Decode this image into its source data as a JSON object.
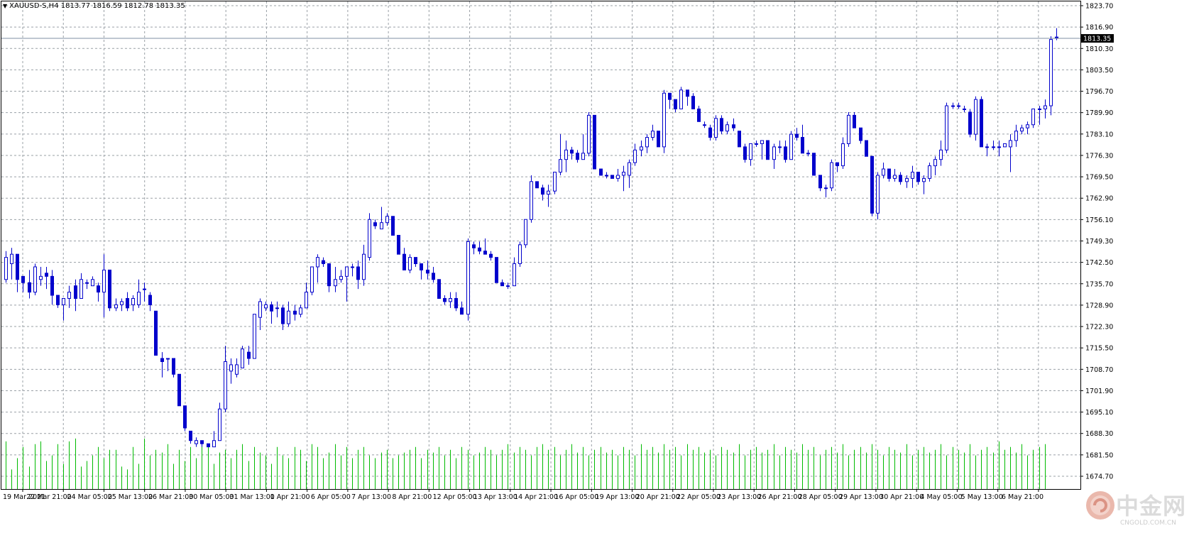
{
  "header": {
    "symbol_line": "XAUUSD-S,H4  1813.77 1816.59 1812.78 1813.35"
  },
  "price_axis": {
    "labels": [
      "1823.70",
      "1816.90",
      "1810.30",
      "1803.50",
      "1796.70",
      "1789.90",
      "1783.10",
      "1776.30",
      "1769.50",
      "1762.90",
      "1756.10",
      "1749.30",
      "1742.50",
      "1735.70",
      "1728.90",
      "1722.30",
      "1715.50",
      "1708.70",
      "1701.90",
      "1695.10",
      "1688.30",
      "1681.50",
      "1674.70"
    ],
    "current_price_label": "1813.35"
  },
  "time_axis": {
    "labels": [
      "19 Mar 2021",
      "22 Mar 21:00",
      "24 Mar 05:00",
      "25 Mar 13:00",
      "26 Mar 21:00",
      "30 Mar 05:00",
      "31 Mar 13:00",
      "1 Apr 21:00",
      "6 Apr 05:00",
      "7 Apr 13:00",
      "8 Apr 21:00",
      "12 Apr 05:00",
      "13 Apr 13:00",
      "14 Apr 21:00",
      "16 Apr 05:00",
      "19 Apr 13:00",
      "20 Apr 21:00",
      "22 Apr 05:00",
      "23 Apr 13:00",
      "26 Apr 21:00",
      "28 Apr 05:00",
      "29 Apr 13:00",
      "30 Apr 21:00",
      "4 May 05:00",
      "5 May 13:00",
      "6 May 21:00"
    ]
  },
  "watermark": {
    "brand_text": "中金网",
    "site_text": "CNGOLD.COM.CN"
  },
  "colors": {
    "candle": "#0000cc",
    "volume": "#00bb00",
    "grid": "#9aa0a6",
    "price_line": "#7f8fa3"
  },
  "chart_data": {
    "type": "candlestick",
    "timeframe": "H4",
    "symbol": "XAUUSD-S",
    "last_bar": {
      "open": 1813.77,
      "high": 1816.59,
      "low": 1812.78,
      "close": 1813.35
    },
    "ylim": [
      1674.7,
      1823.7
    ],
    "grid": true,
    "candles_ohlc": [
      [
        1737,
        1746,
        1736,
        1744
      ],
      [
        1742,
        1747,
        1737,
        1745
      ],
      [
        1745,
        1745,
        1733,
        1737
      ],
      [
        1738,
        1738,
        1733,
        1736
      ],
      [
        1736,
        1740,
        1731,
        1733
      ],
      [
        1733,
        1742,
        1732,
        1741
      ],
      [
        1737,
        1741,
        1735,
        1738
      ],
      [
        1739,
        1741,
        1734,
        1738
      ],
      [
        1738,
        1740,
        1729,
        1732
      ],
      [
        1732,
        1732,
        1728,
        1729
      ],
      [
        1729,
        1731,
        1724,
        1731
      ],
      [
        1731,
        1735,
        1728,
        1733
      ],
      [
        1735,
        1737,
        1727,
        1731
      ],
      [
        1731,
        1739,
        1731,
        1737
      ],
      [
        1736,
        1737,
        1734,
        1736
      ],
      [
        1735,
        1738,
        1735,
        1737
      ],
      [
        1735,
        1736,
        1730,
        1733
      ],
      [
        1733,
        1745,
        1725,
        1740
      ],
      [
        1740,
        1740,
        1727,
        1728
      ],
      [
        1728,
        1731,
        1727,
        1729
      ],
      [
        1729,
        1731,
        1727,
        1730
      ],
      [
        1731,
        1733,
        1727,
        1728
      ],
      [
        1729,
        1732,
        1727,
        1731
      ],
      [
        1729,
        1737,
        1728,
        1733
      ],
      [
        1734,
        1736,
        1730,
        1734
      ],
      [
        1732,
        1733,
        1727,
        1729
      ],
      [
        1727,
        1727,
        1713,
        1713
      ],
      [
        1712,
        1714,
        1706,
        1711
      ],
      [
        1712,
        1712,
        1708,
        1712
      ],
      [
        1712,
        1712,
        1706,
        1707
      ],
      [
        1707,
        1707,
        1697,
        1697
      ],
      [
        1697,
        1697,
        1689,
        1690
      ],
      [
        1689,
        1689,
        1685,
        1686
      ],
      [
        1685,
        1687,
        1684,
        1686
      ],
      [
        1686,
        1686,
        1684,
        1685
      ],
      [
        1685,
        1685,
        1684,
        1684
      ],
      [
        1684,
        1689,
        1684,
        1686
      ],
      [
        1686,
        1698,
        1686,
        1696
      ],
      [
        1696,
        1716,
        1695,
        1711
      ],
      [
        1708,
        1712,
        1704,
        1710
      ],
      [
        1707,
        1712,
        1706,
        1710
      ],
      [
        1709,
        1716,
        1709,
        1715
      ],
      [
        1714,
        1716,
        1710,
        1712
      ],
      [
        1712,
        1725,
        1712,
        1726
      ],
      [
        1725,
        1731,
        1721,
        1730
      ],
      [
        1728,
        1730,
        1727,
        1729
      ],
      [
        1729,
        1730,
        1723,
        1727
      ],
      [
        1728,
        1730,
        1725,
        1728
      ],
      [
        1728,
        1729,
        1721,
        1723
      ],
      [
        1723,
        1730,
        1722,
        1727
      ],
      [
        1727,
        1729,
        1724,
        1726
      ],
      [
        1726,
        1729,
        1725,
        1728
      ],
      [
        1728,
        1736,
        1728,
        1733
      ],
      [
        1733,
        1741,
        1732,
        1741
      ],
      [
        1741,
        1745,
        1736,
        1744
      ],
      [
        1743,
        1744,
        1741,
        1742
      ],
      [
        1742,
        1742,
        1733,
        1735
      ],
      [
        1735,
        1741,
        1733,
        1737
      ],
      [
        1737,
        1740,
        1736,
        1738
      ],
      [
        1738,
        1741,
        1730,
        1741
      ],
      [
        1741,
        1742,
        1738,
        1741
      ],
      [
        1741,
        1743,
        1734,
        1737
      ],
      [
        1737,
        1748,
        1735,
        1745
      ],
      [
        1744,
        1758,
        1743,
        1756
      ],
      [
        1755,
        1756,
        1753,
        1754
      ],
      [
        1753,
        1760,
        1753,
        1755
      ],
      [
        1755,
        1758,
        1754,
        1757
      ],
      [
        1757,
        1757,
        1751,
        1751
      ],
      [
        1751,
        1751,
        1745,
        1745
      ],
      [
        1745,
        1747,
        1740,
        1740
      ],
      [
        1740,
        1745,
        1739,
        1744
      ],
      [
        1744,
        1744,
        1741,
        1742
      ],
      [
        1742,
        1742,
        1737,
        1740
      ],
      [
        1740,
        1743,
        1737,
        1739
      ],
      [
        1739,
        1741,
        1736,
        1737
      ],
      [
        1737,
        1737,
        1731,
        1731
      ],
      [
        1731,
        1732,
        1729,
        1730
      ],
      [
        1730,
        1733,
        1728,
        1731
      ],
      [
        1731,
        1733,
        1727,
        1728
      ],
      [
        1728,
        1730,
        1726,
        1726
      ],
      [
        1726,
        1750,
        1724,
        1749
      ],
      [
        1748,
        1749,
        1745,
        1747
      ],
      [
        1747,
        1749,
        1745,
        1746
      ],
      [
        1746,
        1750,
        1745,
        1745
      ],
      [
        1745,
        1746,
        1743,
        1744
      ],
      [
        1744,
        1744,
        1736,
        1736
      ],
      [
        1736,
        1737,
        1735,
        1735
      ],
      [
        1735,
        1736,
        1734,
        1735
      ],
      [
        1735,
        1744,
        1735,
        1742
      ],
      [
        1742,
        1749,
        1741,
        1748
      ],
      [
        1748,
        1756,
        1747,
        1756
      ],
      [
        1756,
        1770,
        1755,
        1768
      ],
      [
        1768,
        1768,
        1766,
        1766
      ],
      [
        1766,
        1767,
        1762,
        1764
      ],
      [
        1764,
        1767,
        1760,
        1765
      ],
      [
        1765,
        1771,
        1764,
        1771
      ],
      [
        1771,
        1783,
        1770,
        1775
      ],
      [
        1775,
        1781,
        1771,
        1778
      ],
      [
        1778,
        1779,
        1775,
        1777
      ],
      [
        1777,
        1778,
        1774,
        1775
      ],
      [
        1775,
        1783,
        1775,
        1777
      ],
      [
        1777,
        1790,
        1776,
        1789
      ],
      [
        1789,
        1789,
        1772,
        1772
      ],
      [
        1772,
        1772,
        1770,
        1770
      ],
      [
        1770,
        1771,
        1769,
        1770
      ],
      [
        1770,
        1770,
        1769,
        1769
      ],
      [
        1769,
        1772,
        1768,
        1770
      ],
      [
        1770,
        1773,
        1765,
        1771
      ],
      [
        1770,
        1775,
        1766,
        1774
      ],
      [
        1774,
        1780,
        1773,
        1778
      ],
      [
        1778,
        1781,
        1776,
        1779
      ],
      [
        1779,
        1783,
        1777,
        1782
      ],
      [
        1782,
        1786,
        1781,
        1784
      ],
      [
        1784,
        1784,
        1779,
        1779
      ],
      [
        1779,
        1797,
        1777,
        1796
      ],
      [
        1796,
        1796,
        1791,
        1794
      ],
      [
        1794,
        1794,
        1790,
        1791
      ],
      [
        1791,
        1798,
        1791,
        1797
      ],
      [
        1797,
        1797,
        1792,
        1795
      ],
      [
        1795,
        1796,
        1791,
        1791
      ],
      [
        1791,
        1792,
        1787,
        1787
      ],
      [
        1786,
        1787,
        1785,
        1786
      ],
      [
        1785,
        1786,
        1781,
        1782
      ],
      [
        1782,
        1789,
        1781,
        1788
      ],
      [
        1788,
        1789,
        1783,
        1784
      ],
      [
        1784,
        1787,
        1783,
        1786
      ],
      [
        1786,
        1788,
        1784,
        1785
      ],
      [
        1784,
        1784,
        1779,
        1779
      ],
      [
        1779,
        1780,
        1774,
        1775
      ],
      [
        1775,
        1780,
        1773,
        1780
      ],
      [
        1780,
        1781,
        1779,
        1780
      ],
      [
        1780,
        1781,
        1775,
        1781
      ],
      [
        1781,
        1781,
        1775,
        1775
      ],
      [
        1775,
        1780,
        1772,
        1779
      ],
      [
        1779,
        1781,
        1777,
        1779
      ],
      [
        1779,
        1781,
        1774,
        1775
      ],
      [
        1775,
        1784,
        1775,
        1783
      ],
      [
        1783,
        1785,
        1781,
        1782
      ],
      [
        1782,
        1786,
        1777,
        1777
      ],
      [
        1777,
        1778,
        1776,
        1777
      ],
      [
        1777,
        1777,
        1770,
        1770
      ],
      [
        1770,
        1770,
        1765,
        1766
      ],
      [
        1766,
        1767,
        1763,
        1766
      ],
      [
        1766,
        1775,
        1765,
        1774
      ],
      [
        1774,
        1774,
        1771,
        1773
      ],
      [
        1773,
        1782,
        1772,
        1780
      ],
      [
        1780,
        1790,
        1779,
        1789
      ],
      [
        1789,
        1790,
        1785,
        1785
      ],
      [
        1785,
        1785,
        1780,
        1781
      ],
      [
        1781,
        1781,
        1776,
        1776
      ],
      [
        1776,
        1776,
        1757,
        1758
      ],
      [
        1758,
        1771,
        1756,
        1770
      ],
      [
        1770,
        1774,
        1769,
        1772
      ],
      [
        1772,
        1772,
        1768,
        1769
      ],
      [
        1769,
        1772,
        1768,
        1770
      ],
      [
        1770,
        1771,
        1767,
        1768
      ],
      [
        1768,
        1770,
        1766,
        1769
      ],
      [
        1769,
        1773,
        1766,
        1771
      ],
      [
        1771,
        1771,
        1767,
        1768
      ],
      [
        1768,
        1770,
        1764,
        1769
      ],
      [
        1769,
        1774,
        1768,
        1773
      ],
      [
        1773,
        1776,
        1770,
        1775
      ],
      [
        1775,
        1781,
        1773,
        1778
      ],
      [
        1778,
        1793,
        1777,
        1792
      ],
      [
        1792,
        1793,
        1791,
        1792
      ],
      [
        1792,
        1793,
        1791,
        1792
      ],
      [
        1791,
        1792,
        1790,
        1791
      ],
      [
        1790,
        1791,
        1782,
        1783
      ],
      [
        1783,
        1795,
        1781,
        1794
      ],
      [
        1794,
        1795,
        1779,
        1779
      ],
      [
        1779,
        1780,
        1776,
        1779
      ],
      [
        1779,
        1781,
        1778,
        1779
      ],
      [
        1779,
        1781,
        1776,
        1779
      ],
      [
        1779,
        1780,
        1779,
        1780
      ],
      [
        1779,
        1783,
        1771,
        1781
      ],
      [
        1781,
        1786,
        1779,
        1784
      ],
      [
        1784,
        1786,
        1783,
        1785
      ],
      [
        1785,
        1787,
        1783,
        1786
      ],
      [
        1786,
        1791,
        1785,
        1791
      ],
      [
        1791,
        1792,
        1786,
        1791
      ],
      [
        1791,
        1794,
        1788,
        1792
      ],
      [
        1792,
        1814,
        1789,
        1813
      ],
      [
        1813.77,
        1816.59,
        1812.78,
        1813.35
      ]
    ],
    "volume": [
      85,
      35,
      55,
      75,
      40,
      80,
      85,
      50,
      60,
      80,
      45,
      85,
      90,
      40,
      50,
      60,
      75,
      55,
      70,
      70,
      40,
      35,
      75,
      45,
      90,
      60,
      70,
      65,
      80,
      45,
      70,
      50,
      75,
      55,
      85,
      80,
      45,
      65,
      70,
      55,
      70,
      80,
      50,
      75,
      65,
      60,
      45,
      75,
      60,
      55,
      75,
      70,
      50,
      80,
      75,
      55,
      65,
      80,
      60,
      75,
      55,
      70,
      75,
      60,
      55,
      65,
      70,
      55,
      60,
      65,
      70,
      75,
      55,
      70,
      65,
      75,
      60,
      70,
      55,
      75,
      70,
      60,
      65,
      75,
      70,
      60,
      70,
      80,
      65,
      75,
      70,
      60,
      75,
      80,
      70,
      75,
      60,
      70,
      80,
      65,
      75,
      60,
      70,
      75,
      65,
      70,
      60,
      75,
      70,
      60,
      80,
      70,
      75,
      65,
      80,
      70,
      75,
      60,
      80,
      70,
      75,
      65,
      70,
      60,
      75,
      70,
      65,
      80,
      60,
      70,
      75,
      65,
      70,
      80,
      60,
      75,
      70,
      65,
      80,
      70,
      75,
      60,
      70,
      75,
      65,
      80,
      60,
      70,
      75,
      65,
      80,
      70,
      60,
      75,
      70,
      65,
      80,
      60,
      70,
      75,
      65,
      70,
      80,
      60,
      75,
      70,
      65,
      80,
      60,
      70,
      75,
      65,
      85,
      70,
      75,
      65,
      80,
      60,
      70,
      75,
      80
    ]
  }
}
